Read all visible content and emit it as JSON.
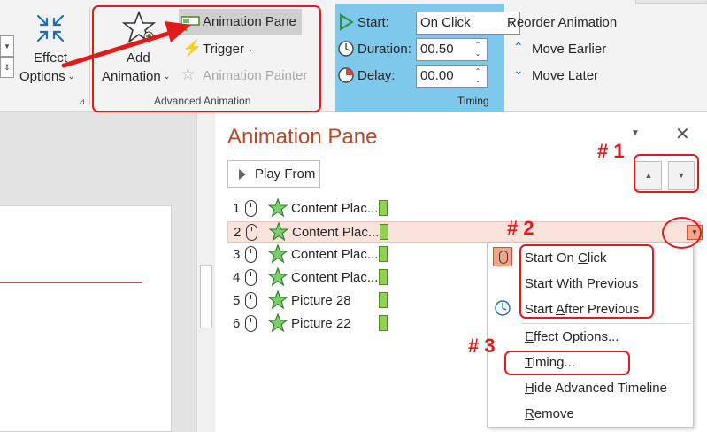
{
  "ribbon": {
    "effect_options": {
      "line1": "Effect",
      "line2": "Options"
    },
    "add_animation": {
      "line1": "Add",
      "line2": "Animation"
    },
    "animation_pane": "Animation Pane",
    "trigger": "Trigger",
    "animation_painter": "Animation Painter",
    "advanced_animation_group": "Advanced Animation",
    "timing": {
      "start_label": "Start:",
      "start_value": "On Click",
      "duration_label": "Duration:",
      "duration_value": "00.50",
      "delay_label": "Delay:",
      "delay_value": "00.00",
      "group_label": "Timing"
    },
    "reorder": {
      "title": "Reorder Animation",
      "move_earlier": "Move Earlier",
      "move_later": "Move Later"
    }
  },
  "pane": {
    "title": "Animation Pane",
    "play_from": "Play From",
    "items": [
      {
        "num": "1",
        "name": "Content Plac..."
      },
      {
        "num": "2",
        "name": "Content Plac..."
      },
      {
        "num": "3",
        "name": "Content Plac..."
      },
      {
        "num": "4",
        "name": "Content Plac..."
      },
      {
        "num": "5",
        "name": "Picture 28"
      },
      {
        "num": "6",
        "name": "Picture 22"
      }
    ]
  },
  "context_menu": {
    "start_on_click": {
      "pre": "Start On ",
      "u": "C",
      "post": "lick"
    },
    "start_with_previous": {
      "pre": "Start ",
      "u": "W",
      "post": "ith Previous"
    },
    "start_after_previous": {
      "pre": "Start ",
      "u": "A",
      "post": "fter Previous"
    },
    "effect_options": {
      "pre": "",
      "u": "E",
      "post": "ffect Options..."
    },
    "timing": {
      "pre": "",
      "u": "T",
      "post": "iming..."
    },
    "hide_advanced_timeline": {
      "pre": "",
      "u": "H",
      "post": "ide Advanced Timeline"
    },
    "remove": {
      "pre": "",
      "u": "R",
      "post": "emove"
    }
  },
  "annotations": {
    "label1": "# 1",
    "label2": "# 2",
    "label3": "# 3"
  },
  "colors": {
    "accent_red": "#e31a1a",
    "pane_title": "#b7472a",
    "timing_highlight": "#7ec8ec",
    "selected_row": "#fbe3db",
    "timing_bar": "#92d050"
  }
}
